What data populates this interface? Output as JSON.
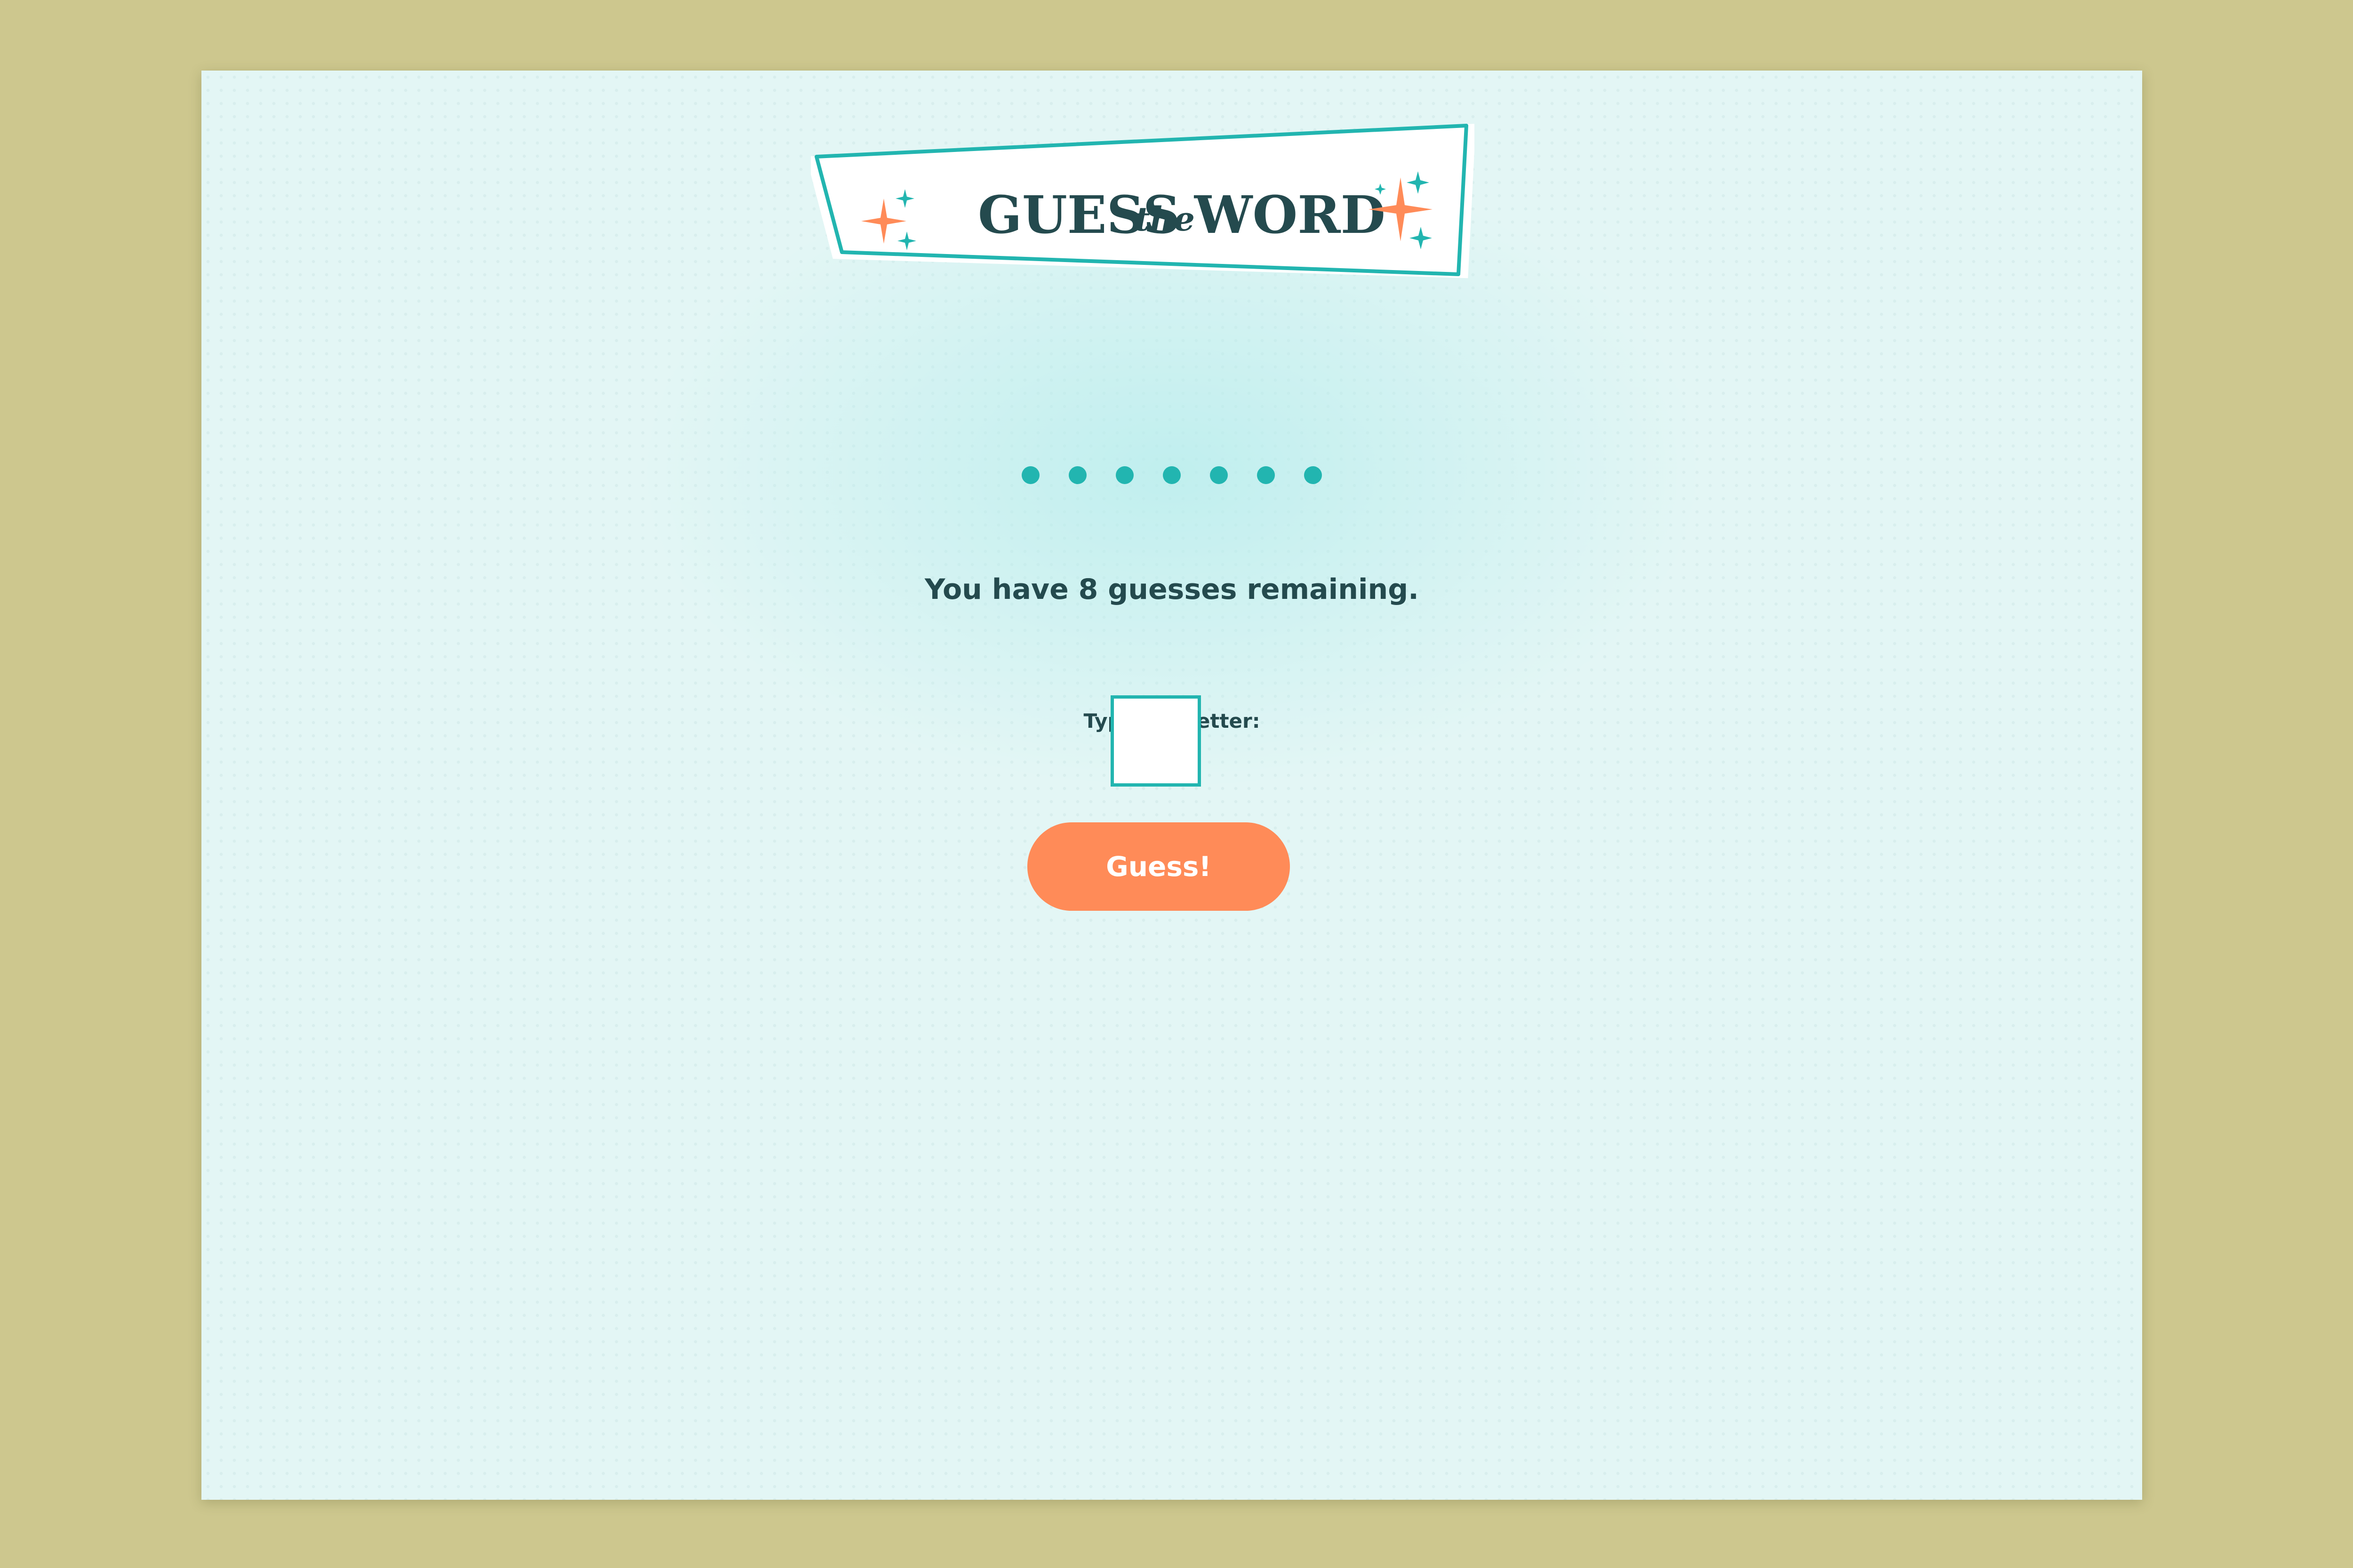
{
  "game": {
    "title_main_1": "GUESS",
    "title_small": "the",
    "title_main_2": "WORD",
    "word_dots": [
      "●",
      "●",
      "●",
      "●",
      "●",
      "●",
      "●"
    ],
    "guesses_remaining_text": "You have 8 guesses remaining.",
    "letter_label": "Type one letter:",
    "letter_input_value": "",
    "guess_button_label": "Guess!"
  },
  "colors": {
    "page_background": "#cdc78e",
    "panel_background": "#e3f6f5",
    "accent_teal": "#22b5b0",
    "accent_orange": "#ff8b58",
    "text_dark": "#244a4e"
  },
  "icons": [
    "sparkle-icon"
  ]
}
